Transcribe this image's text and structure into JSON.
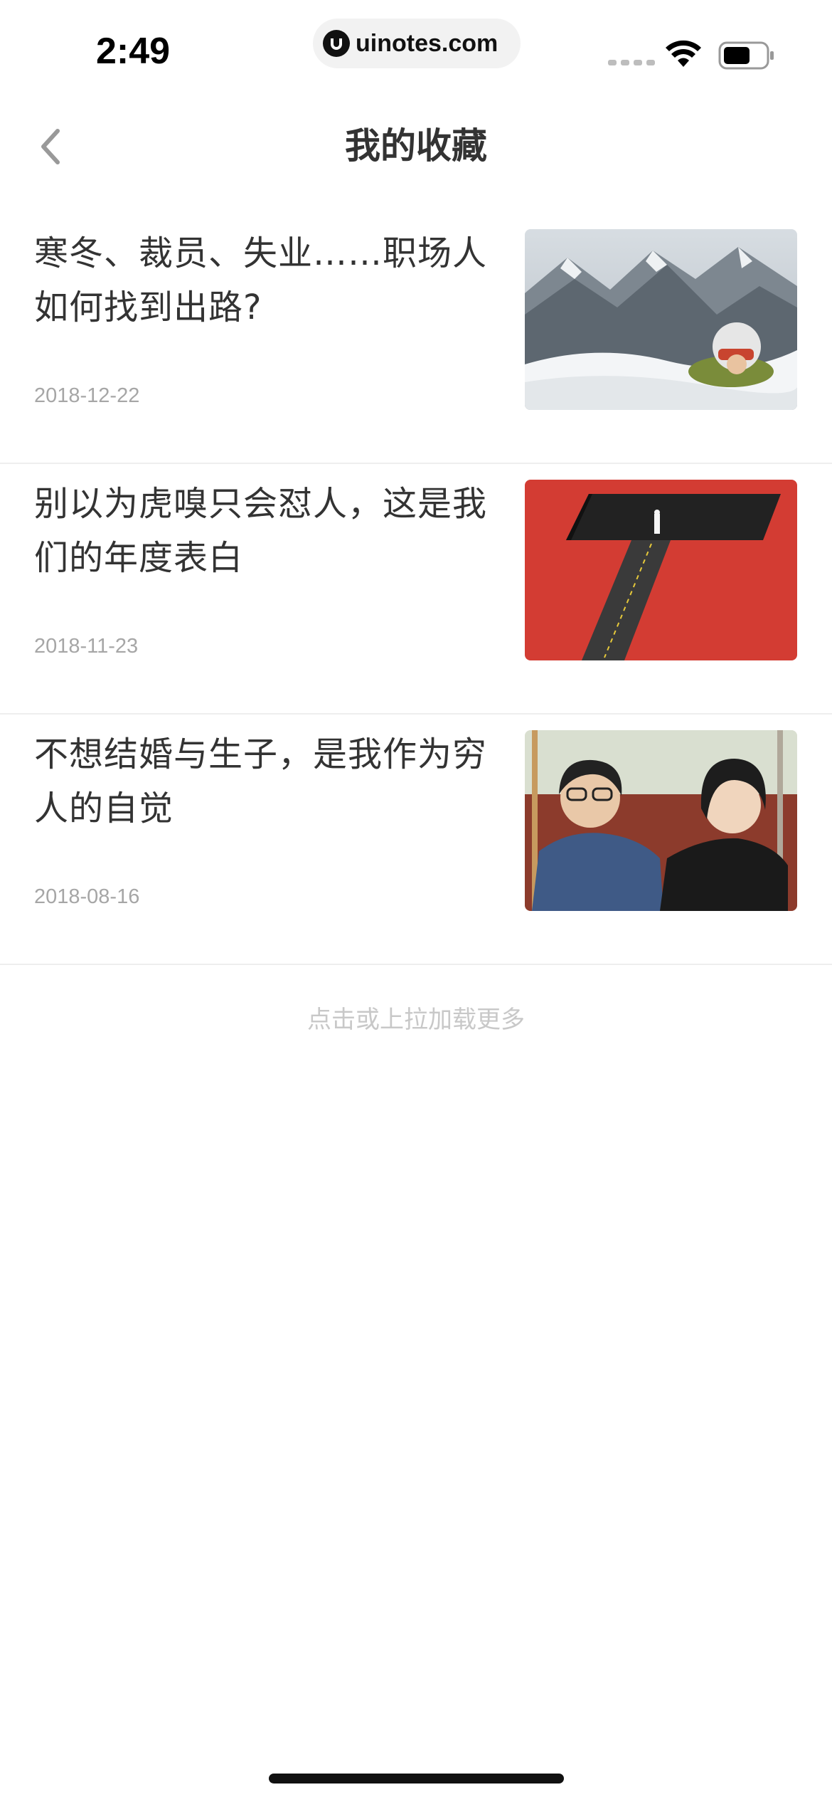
{
  "status_bar": {
    "time": "2:49",
    "url": "uinotes.com",
    "icons": [
      "signal-icon",
      "wifi-icon",
      "battery-icon"
    ]
  },
  "nav": {
    "title": "我的收藏",
    "back_icon": "chevron-left-icon"
  },
  "favorites": [
    {
      "title": "寒冬、裁员、失业……职场人如何找到出路?",
      "date": "2018-12-22",
      "thumbnail": "snowy-mountain-climber"
    },
    {
      "title": "别以为虎嗅只会怼人，这是我们的年度表白",
      "date": "2018-11-23",
      "thumbnail": "red-road-t-illustration"
    },
    {
      "title": "不想结婚与生子，是我作为穷人的自觉",
      "date": "2018-08-16",
      "thumbnail": "two-people-sitting"
    }
  ],
  "load_more": "点击或上拉加载更多",
  "colors": {
    "text_primary": "#333333",
    "text_secondary": "#a6a6a6",
    "divider": "#eeeeee",
    "load_more": "#c8c8c8"
  }
}
